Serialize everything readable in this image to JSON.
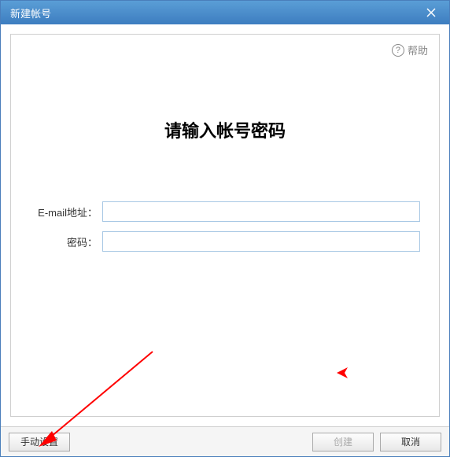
{
  "titlebar": {
    "title": "新建帐号"
  },
  "help": {
    "label": "帮助"
  },
  "main": {
    "heading": "请输入帐号密码",
    "email_label": "E-mail地址：",
    "email_value": "",
    "password_label": "密码：",
    "password_value": ""
  },
  "buttons": {
    "manual": "手动设置",
    "create": "创建",
    "cancel": "取消"
  }
}
